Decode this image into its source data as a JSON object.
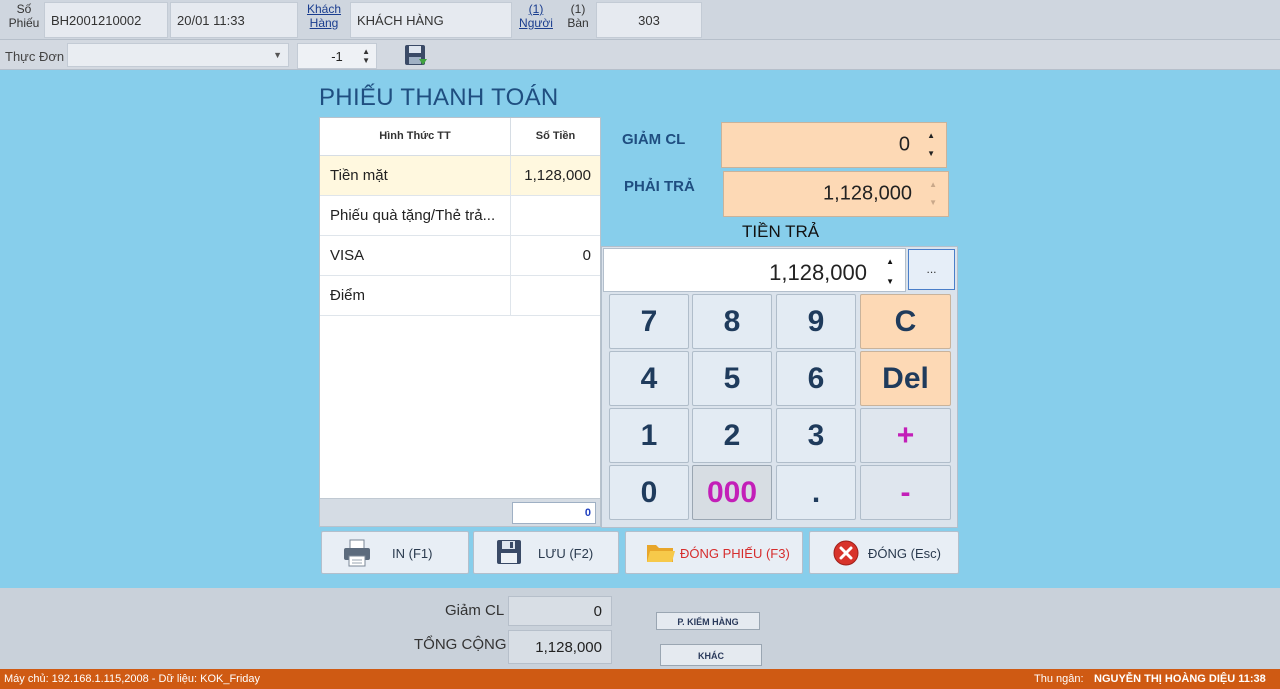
{
  "topbar": {
    "so_phieu_label": "Số Phiếu",
    "so_phieu_value": "BH2001210002",
    "datetime": "20/01 11:33",
    "khach_hang_label": "Khách Hàng",
    "khach_hang_value": "KHÁCH HÀNG",
    "nguoi_count": "(1)",
    "nguoi_label": "Người",
    "ban_count": "(1)",
    "ban_label": "Bàn",
    "ban_value": "303"
  },
  "menubar": {
    "thuc_don_label": "Thực Đơn",
    "spin_value": "-1"
  },
  "dialog": {
    "title": "PHIẾU THANH TOÁN",
    "grid": {
      "col_method": "Hình Thức TT",
      "col_amount": "Số Tiền",
      "rows": [
        {
          "method": "Tiền mặt",
          "amount": "1,128,000"
        },
        {
          "method": "Phiếu quà tặng/Thẻ trả...",
          "amount": ""
        },
        {
          "method": "VISA",
          "amount": "0"
        },
        {
          "method": "Điểm",
          "amount": ""
        }
      ],
      "footer_total": "0"
    },
    "giam_cl_label": "GIẢM CL",
    "giam_cl_value": "0",
    "phai_tra_label": "PHẢI TRẢ",
    "phai_tra_value": "1,128,000",
    "tien_tra_label": "TIỀN TRẢ",
    "tien_tra_value": "1,128,000",
    "dots_label": "...",
    "keys": [
      "7",
      "8",
      "9",
      "C",
      "4",
      "5",
      "6",
      "Del",
      "1",
      "2",
      "3",
      "+",
      "0",
      "000",
      ".",
      "-"
    ],
    "buttons": {
      "print": "IN (F1)",
      "save": "LƯU (F2)",
      "close_bill": "ĐÓNG PHIẾU (F3)",
      "close": "ĐÓNG (Esc)"
    }
  },
  "bottom": {
    "giam_cl_label": "Giảm CL",
    "giam_cl_value": "0",
    "tong_cong_label": "TỔNG CỘNG",
    "tong_cong_value": "1,128,000",
    "tab_kiem_hang": "P. KIỂM HÀNG",
    "tab_khac": "KHÁC"
  },
  "status": {
    "left": "Máy chủ: 192.168.1.115,2008 - Dữ liệu: KOK_Friday",
    "cashier_label": "Thu ngân:",
    "cashier_value": "NGUYỄN THỊ HOÀNG DIỆU 11:38"
  },
  "colors": {
    "overlay": "#87ceeb",
    "accent_orange": "#fdd9b5",
    "title_blue": "#1f4e80",
    "magenta": "#c31fb8",
    "statusbar": "#cf5a13"
  }
}
